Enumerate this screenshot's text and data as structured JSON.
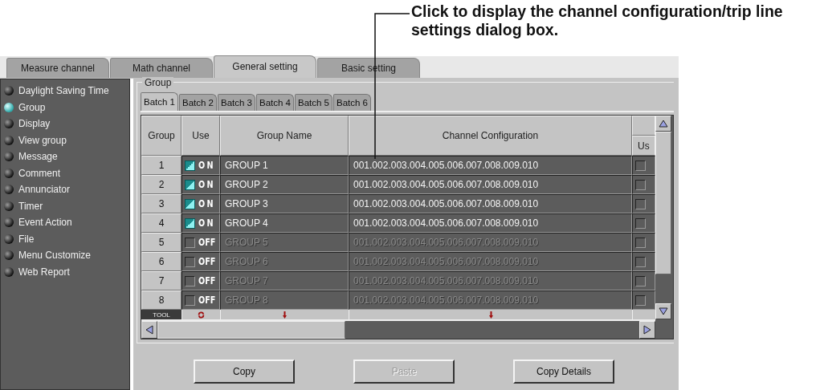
{
  "callout": "Click to display the channel configuration/trip line settings dialog box.",
  "tabs": [
    {
      "label": "Measure channel",
      "selected": false
    },
    {
      "label": "Math channel",
      "selected": false
    },
    {
      "label": "General setting",
      "selected": true
    },
    {
      "label": "Basic setting",
      "selected": false
    }
  ],
  "sidebar": {
    "items": [
      {
        "label": "Daylight Saving Time",
        "selected": false
      },
      {
        "label": "Group",
        "selected": true
      },
      {
        "label": "Display",
        "selected": false
      },
      {
        "label": "View group",
        "selected": false
      },
      {
        "label": "Message",
        "selected": false
      },
      {
        "label": "Comment",
        "selected": false
      },
      {
        "label": "Annunciator",
        "selected": false
      },
      {
        "label": "Timer",
        "selected": false
      },
      {
        "label": "Event Action",
        "selected": false
      },
      {
        "label": "File",
        "selected": false
      },
      {
        "label": "Menu Customize",
        "selected": false
      },
      {
        "label": "Web Report",
        "selected": false
      }
    ]
  },
  "group_panel": {
    "title": "Group",
    "batch_tabs": [
      {
        "label": "Batch 1",
        "selected": true
      },
      {
        "label": "Batch 2",
        "selected": false
      },
      {
        "label": "Batch 3",
        "selected": false
      },
      {
        "label": "Batch 4",
        "selected": false
      },
      {
        "label": "Batch 5",
        "selected": false
      },
      {
        "label": "Batch 6",
        "selected": false
      }
    ],
    "table": {
      "columns": [
        "Group",
        "Use",
        "Group Name",
        "Channel Configuration",
        "Us"
      ],
      "rows": [
        {
          "group": "1",
          "on": true,
          "use": "ON",
          "name": "GROUP 1",
          "channels": "001.002.003.004.005.006.007.008.009.010"
        },
        {
          "group": "2",
          "on": true,
          "use": "ON",
          "name": "GROUP 2",
          "channels": "001.002.003.004.005.006.007.008.009.010"
        },
        {
          "group": "3",
          "on": true,
          "use": "ON",
          "name": "GROUP 3",
          "channels": "001.002.003.004.005.006.007.008.009.010"
        },
        {
          "group": "4",
          "on": true,
          "use": "ON",
          "name": "GROUP 4",
          "channels": "001.002.003.004.005.006.007.008.009.010"
        },
        {
          "group": "5",
          "on": false,
          "use": "OFF",
          "name": "GROUP 5",
          "channels": "001.002.003.004.005.006.007.008.009.010"
        },
        {
          "group": "6",
          "on": false,
          "use": "OFF",
          "name": "GROUP 6",
          "channels": "001.002.003.004.005.006.007.008.009.010"
        },
        {
          "group": "7",
          "on": false,
          "use": "OFF",
          "name": "GROUP 7",
          "channels": "001.002.003.004.005.006.007.008.009.010"
        },
        {
          "group": "8",
          "on": false,
          "use": "OFF",
          "name": "GROUP 8",
          "channels": "001.002.003.004.005.006.007.008.009.010"
        }
      ],
      "tool_label": "TOOL"
    }
  },
  "last_column_checked": [
    false,
    false,
    false,
    false,
    false,
    false,
    false,
    false
  ],
  "buttons": [
    {
      "label": "Copy",
      "disabled": false
    },
    {
      "label": "Paste",
      "disabled": true
    },
    {
      "label": "Copy Details",
      "disabled": false
    }
  ]
}
